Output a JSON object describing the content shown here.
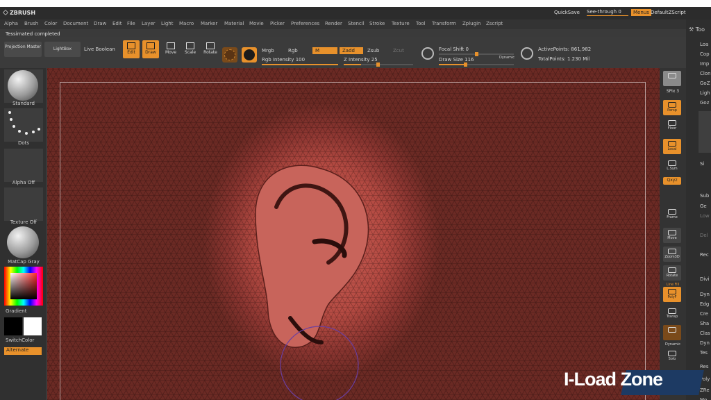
{
  "app": {
    "logo": "ZBRUSH"
  },
  "titlebar": {
    "quicksave": "QuickSave",
    "seethrough": "See-through",
    "seethrough_value": "0",
    "menus": "Menus",
    "script": "DefaultZScript"
  },
  "menubar": [
    "Alpha",
    "Brush",
    "Color",
    "Document",
    "Draw",
    "Edit",
    "File",
    "Layer",
    "Light",
    "Macro",
    "Marker",
    "Material",
    "Movie",
    "Picker",
    "Preferences",
    "Render",
    "Stencil",
    "Stroke",
    "Texture",
    "Tool",
    "Transform",
    "Zplugin",
    "Zscript"
  ],
  "status": {
    "message": "Tessimated completed"
  },
  "shelf": {
    "projection_master": "Projection Master",
    "lightbox": "LightBox",
    "live_boolean": "Live Boolean",
    "edit": "Edit",
    "draw": "Draw",
    "move": "Move",
    "scale": "Scale",
    "rotate": "Rotate",
    "mrgb": "Mrgb",
    "rgb": "Rgb",
    "m": "M",
    "zadd": "Zadd",
    "zsub": "Zsub",
    "zcut": "Zcut",
    "rgb_intensity_label": "Rgb Intensity",
    "rgb_intensity_value": "100",
    "z_intensity_label": "Z Intensity",
    "z_intensity_value": "25",
    "focal_shift_label": "Focal Shift",
    "focal_shift_value": "0",
    "draw_size_label": "Draw Size",
    "draw_size_value": "116",
    "dynamic": "Dynamic",
    "active_points_label": "ActivePoints:",
    "active_points_value": "861,982",
    "total_points_label": "TotalPoints:",
    "total_points_value": "1.230 Mil"
  },
  "lefttray": {
    "brush": "Standard",
    "stroke": "Dots",
    "alpha": "Alpha Off",
    "texture": "Texture Off",
    "material": "MatCap Gray",
    "gradient": "Gradient",
    "switchcolor": "SwitchColor",
    "alternate": "Alternate"
  },
  "rightstrip": {
    "spix_label": "SPix",
    "spix_value": "3",
    "persp": "Persp",
    "floor": "Floor",
    "local": "Local",
    "lsym": "L.Sym",
    "qxyz": "Qxyz",
    "frame": "Frame",
    "move": "Move",
    "zoom3d": "Zoom3D",
    "rotate": "Rotate",
    "linefill": "Line Fill",
    "polyf": "PolyF",
    "transp": "Transp",
    "dynamic": "Dynamic",
    "solo": "Solo"
  },
  "farright": {
    "tool": "Too",
    "items": [
      "Loa",
      "Cop",
      "Imp",
      "Clon",
      "GoZ",
      "Ligh",
      "Goz"
    ],
    "si": "Si",
    "sub": "Sub",
    "ge": "Ge",
    "items2": [
      "Low",
      "Del",
      "Rec",
      "Divi",
      "Dyn",
      "Edg",
      "Cre",
      "Sha",
      "Clas",
      "Dyn",
      "Tes",
      "Res",
      "Poly",
      "ZRe",
      "Mo"
    ]
  },
  "watermark": {
    "text": "I-Load Zone"
  },
  "colors": {
    "accent": "#e8912b",
    "mesh": "#b44a42"
  }
}
